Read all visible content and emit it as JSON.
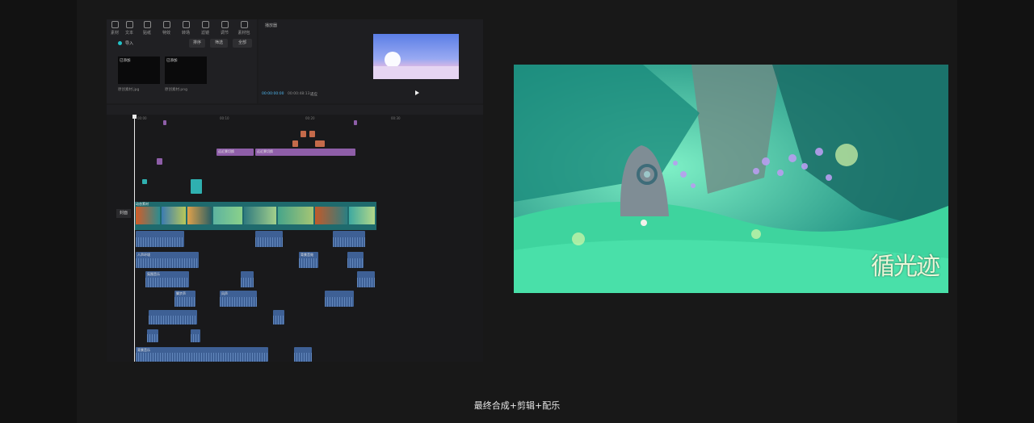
{
  "caption": "最终合成+剪辑+配乐",
  "media_panel": {
    "tools": [
      "素材",
      "文本",
      "贴纸",
      "特效",
      "转场",
      "滤镜",
      "调节",
      "素材包"
    ],
    "imported_label": "导入",
    "buttons": [
      "排序",
      "筛选",
      "全部"
    ],
    "thumbs": [
      {
        "label": "已添加",
        "file": "原创素材.jpg"
      },
      {
        "label": "已添加",
        "file": "原创素材.png"
      }
    ]
  },
  "player": {
    "title": "播放器",
    "current_time": "00:00:00:00",
    "total_time": "00:00:48:13",
    "ratio": "适应"
  },
  "timeline": {
    "ruler": [
      "00:00",
      "00:10",
      "00:20",
      "00:30"
    ],
    "cover_label": "封面",
    "sticker_labels": [
      "远近景切换",
      "远近景切换"
    ],
    "video_label": "动态素材",
    "audio_labels": [
      "人声环境",
      "背景音效",
      "氛围音乐",
      "脚步声",
      "风声",
      "背景音乐"
    ]
  },
  "game_logo": "循光迹",
  "colors": {
    "audio": "#3e6095",
    "sticker": "#8e5ea8",
    "video": "#1f6a6d",
    "accent": "#22c3c8"
  }
}
